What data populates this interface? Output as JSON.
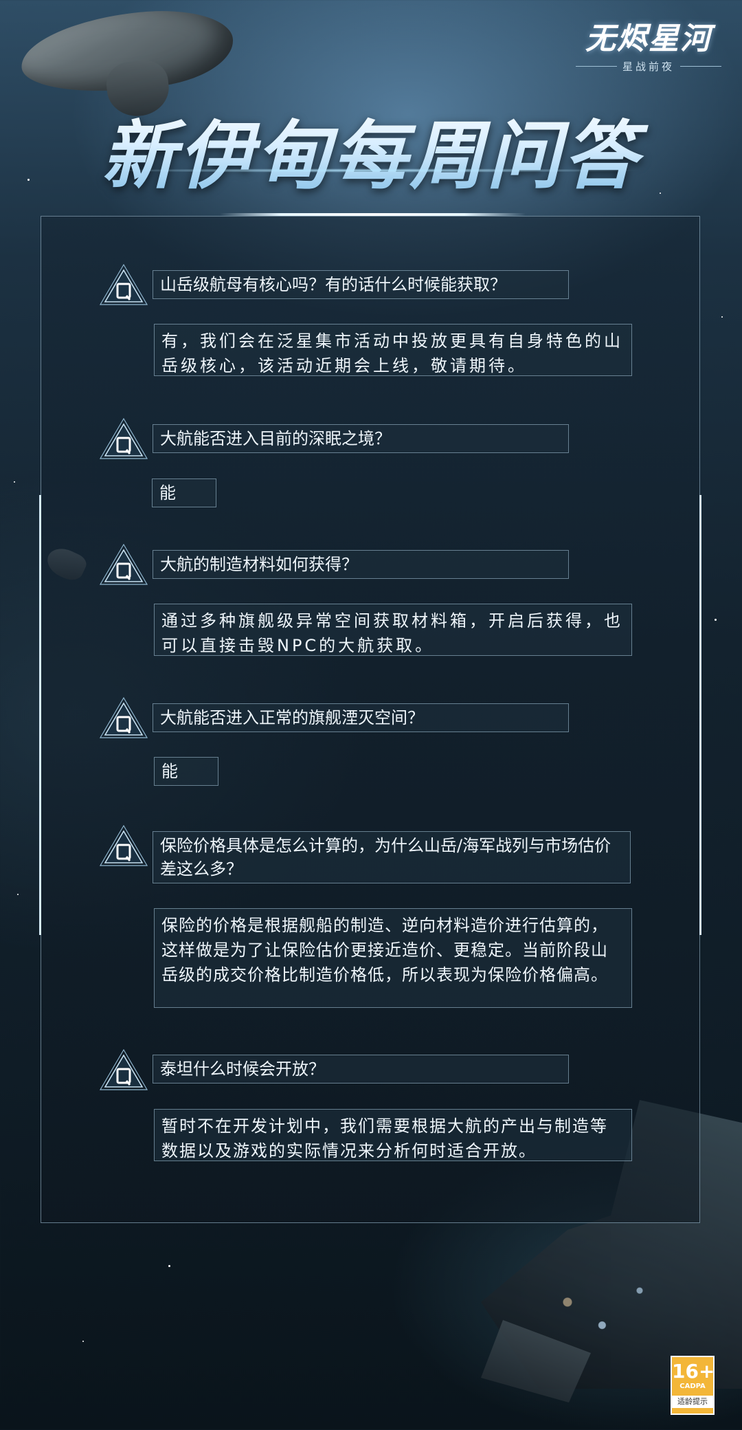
{
  "header": {
    "logo_title": "无烬星河",
    "logo_subtitle": "星战前夜",
    "main_title": "新伊甸每周问答"
  },
  "qa": [
    {
      "q_label": "Q",
      "question": "山岳级航母有核心吗？有的话什么时候能获取？",
      "answer": "有，我们会在泛星集市活动中投放更具有自身特色的山岳级核心，该活动近期会上线，敬请期待。"
    },
    {
      "q_label": "Q",
      "question": "大航能否进入目前的深眠之境？",
      "answer": "能"
    },
    {
      "q_label": "Q",
      "question": "大航的制造材料如何获得？",
      "answer": "通过多种旗舰级异常空间获取材料箱，开启后获得，也可以直接击毁NPC的大航获取。"
    },
    {
      "q_label": "Q",
      "question": "大航能否进入正常的旗舰湮灭空间？",
      "answer": "能"
    },
    {
      "q_label": "Q",
      "question": "保险价格具体是怎么计算的，为什么山岳/海军战列与市场估价差这么多？",
      "answer": "保险的价格是根据舰船的制造、逆向材料造价进行估算的，这样做是为了让保险估价更接近造价、更稳定。当前阶段山岳级的成交价格比制造价格低，所以表现为保险价格偏高。"
    },
    {
      "q_label": "Q",
      "question": "泰坦什么时候会开放？",
      "answer": "暂时不在开发计划中，我们需要根据大航的产出与制造等数据以及游戏的实际情况来分析何时适合开放。"
    }
  ],
  "age_badge": {
    "age": "16+",
    "org": "CADPA",
    "tip": "适龄提示"
  },
  "colors": {
    "accent": "#d6ecfa",
    "badge": "#f3b638",
    "text": "#eef5fa"
  }
}
